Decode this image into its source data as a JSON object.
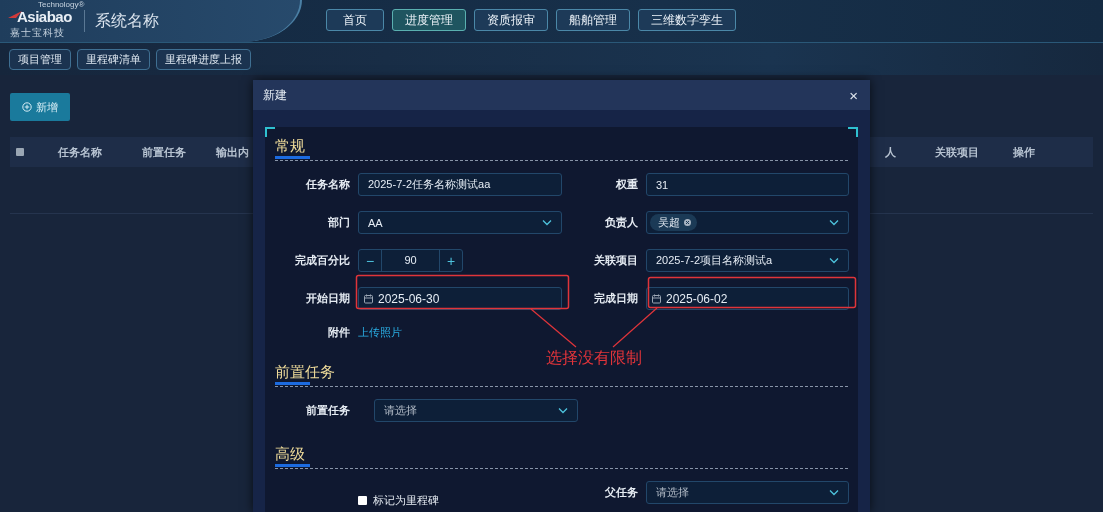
{
  "header": {
    "logo": {
      "text": "Asiabao",
      "tagline": "Technology®",
      "subtitle": "嘉士宝科技"
    },
    "system_name": "系统名称",
    "nav": [
      {
        "label": "首页",
        "selected": false
      },
      {
        "label": "进度管理",
        "selected": true
      },
      {
        "label": "资质报审",
        "selected": false
      },
      {
        "label": "船舶管理",
        "selected": false
      },
      {
        "label": "三维数字孪生",
        "selected": false
      }
    ]
  },
  "subnav": [
    {
      "label": "项目管理"
    },
    {
      "label": "里程碑清单"
    },
    {
      "label": "里程碑进度上报"
    }
  ],
  "toolbar": {
    "add_button": "新增"
  },
  "table": {
    "select_all": {
      "checked": false
    },
    "columns_left": [
      "任务名称",
      "前置任务",
      "输出内"
    ],
    "columns_right": [
      "人",
      "关联项目",
      "操作"
    ]
  },
  "dialog": {
    "title": "新建",
    "close": "×",
    "sections": [
      {
        "title": "常规",
        "fields": [
          {
            "kind": "text",
            "label": "任务名称",
            "value": "2025-7-2任务名称测试aa"
          },
          {
            "kind": "text",
            "label": "权重",
            "value": "31"
          },
          {
            "kind": "select",
            "label": "部门",
            "value": "AA"
          },
          {
            "kind": "tags",
            "label": "负责人",
            "tags": [
              "吴超"
            ]
          },
          {
            "kind": "stepper",
            "label": "完成百分比",
            "value": "90",
            "minus": "−",
            "plus": "+"
          },
          {
            "kind": "select",
            "label": "关联项目",
            "value": "2025-7-2项目名称测试a"
          },
          {
            "kind": "date",
            "label": "开始日期",
            "value": "2025-06-30"
          },
          {
            "kind": "date",
            "label": "完成日期",
            "value": "2025-06-02"
          },
          {
            "kind": "upload",
            "label": "附件",
            "link": "上传照片"
          }
        ]
      },
      {
        "title": "前置任务",
        "fields": [
          {
            "kind": "select",
            "label": "前置任务",
            "placeholder": "请选择"
          }
        ]
      },
      {
        "title": "高级",
        "fields": [
          {
            "kind": "checkbox",
            "label": "标记为里程碑",
            "checked": false
          },
          {
            "kind": "select",
            "label": "父任务",
            "placeholder": "请选择"
          }
        ]
      }
    ]
  },
  "annotation": {
    "text": "选择没有限制"
  }
}
